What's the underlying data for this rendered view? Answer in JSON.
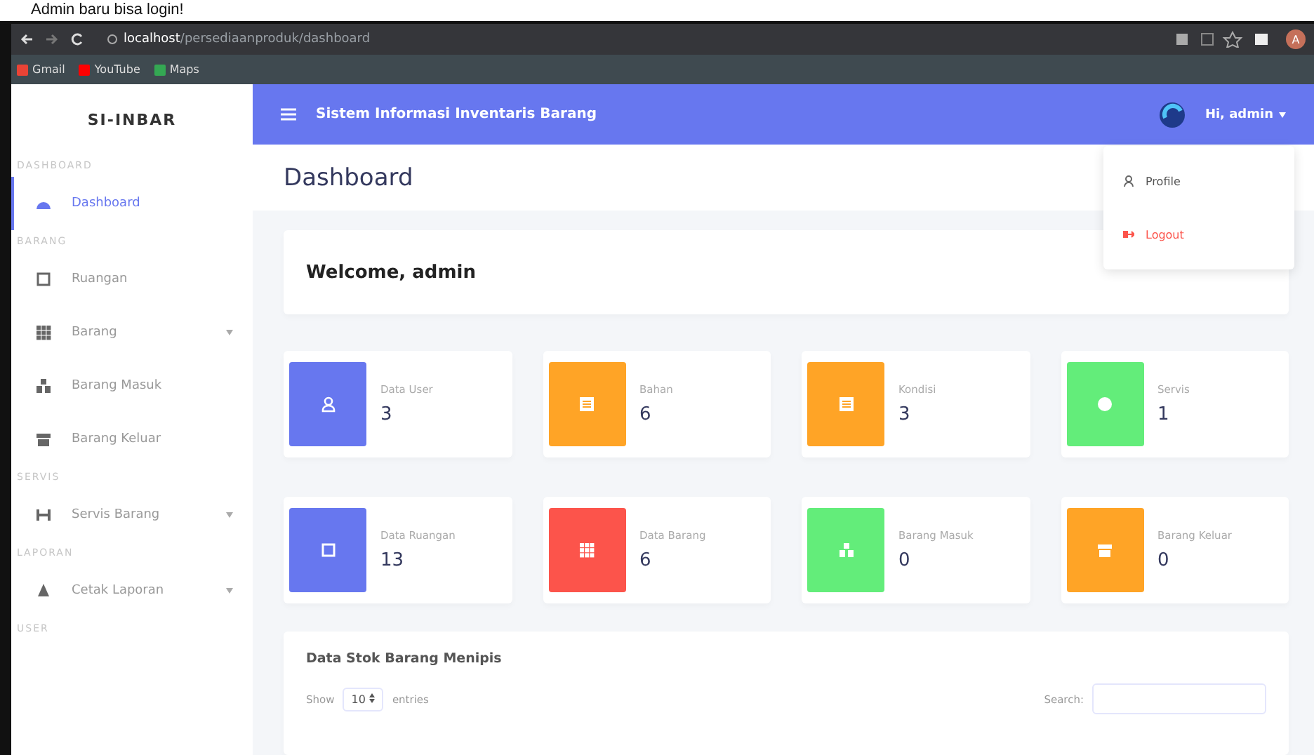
{
  "caption": "Admin baru bisa login!",
  "browser": {
    "url_host": "localhost",
    "url_path": "/persediaanproduk/dashboard",
    "bookmarks": [
      "Gmail",
      "YouTube",
      "Maps"
    ],
    "profile": "A"
  },
  "sidebar": {
    "brand": "SI-INBAR",
    "sections": [
      {
        "heading": "DASHBOARD",
        "items": [
          {
            "label": "Dashboard",
            "kind": "gauge",
            "selected": true,
            "expandable": false
          }
        ]
      },
      {
        "heading": "BARANG",
        "items": [
          {
            "label": "Ruangan",
            "kind": "square",
            "selected": false,
            "expandable": false
          },
          {
            "label": "Barang",
            "kind": "grid",
            "selected": false,
            "expandable": true
          },
          {
            "label": "Barang Masuk",
            "kind": "boxes",
            "selected": false,
            "expandable": false
          },
          {
            "label": "Barang Keluar",
            "kind": "box",
            "selected": false,
            "expandable": false
          }
        ]
      },
      {
        "heading": "SERVIS",
        "items": [
          {
            "label": "Servis Barang",
            "kind": "tool",
            "selected": false,
            "expandable": true
          }
        ]
      },
      {
        "heading": "LAPORAN",
        "items": [
          {
            "label": "Cetak Laporan",
            "kind": "print",
            "selected": false,
            "expandable": true
          }
        ]
      },
      {
        "heading": "USER"
      }
    ]
  },
  "navbar": {
    "title": "Sistem Informasi Inventaris Barang",
    "user": "Hi, admin",
    "menu": [
      {
        "label": "Profile",
        "kind": "normal"
      },
      {
        "label": "Logout",
        "kind": "danger"
      }
    ]
  },
  "page_title": "Dashboard",
  "welcome": "Welcome, admin",
  "stats": [
    {
      "label": "Data User",
      "value": "3",
      "kind": "user",
      "color": "#6777ef"
    },
    {
      "label": "Bahan",
      "value": "6",
      "kind": "list",
      "color": "#ffa426"
    },
    {
      "label": "Kondisi",
      "value": "3",
      "kind": "list",
      "color": "#ffa426"
    },
    {
      "label": "Servis",
      "value": "1",
      "kind": "circle",
      "color": "#63ed7a"
    },
    {
      "label": "Data Ruangan",
      "value": "13",
      "kind": "square",
      "color": "#6777ef"
    },
    {
      "label": "Data Barang",
      "value": "6",
      "kind": "grid",
      "color": "#fc544b"
    },
    {
      "label": "Barang Masuk",
      "value": "0",
      "kind": "boxes",
      "color": "#63ed7a"
    },
    {
      "label": "Barang Keluar",
      "value": "0",
      "kind": "box",
      "color": "#ffa426"
    }
  ],
  "table": {
    "title": "Data Stok Barang Menipis",
    "show_label": "Show",
    "entries_value": "10",
    "entries_label": "entries",
    "search_label": "Search:"
  }
}
